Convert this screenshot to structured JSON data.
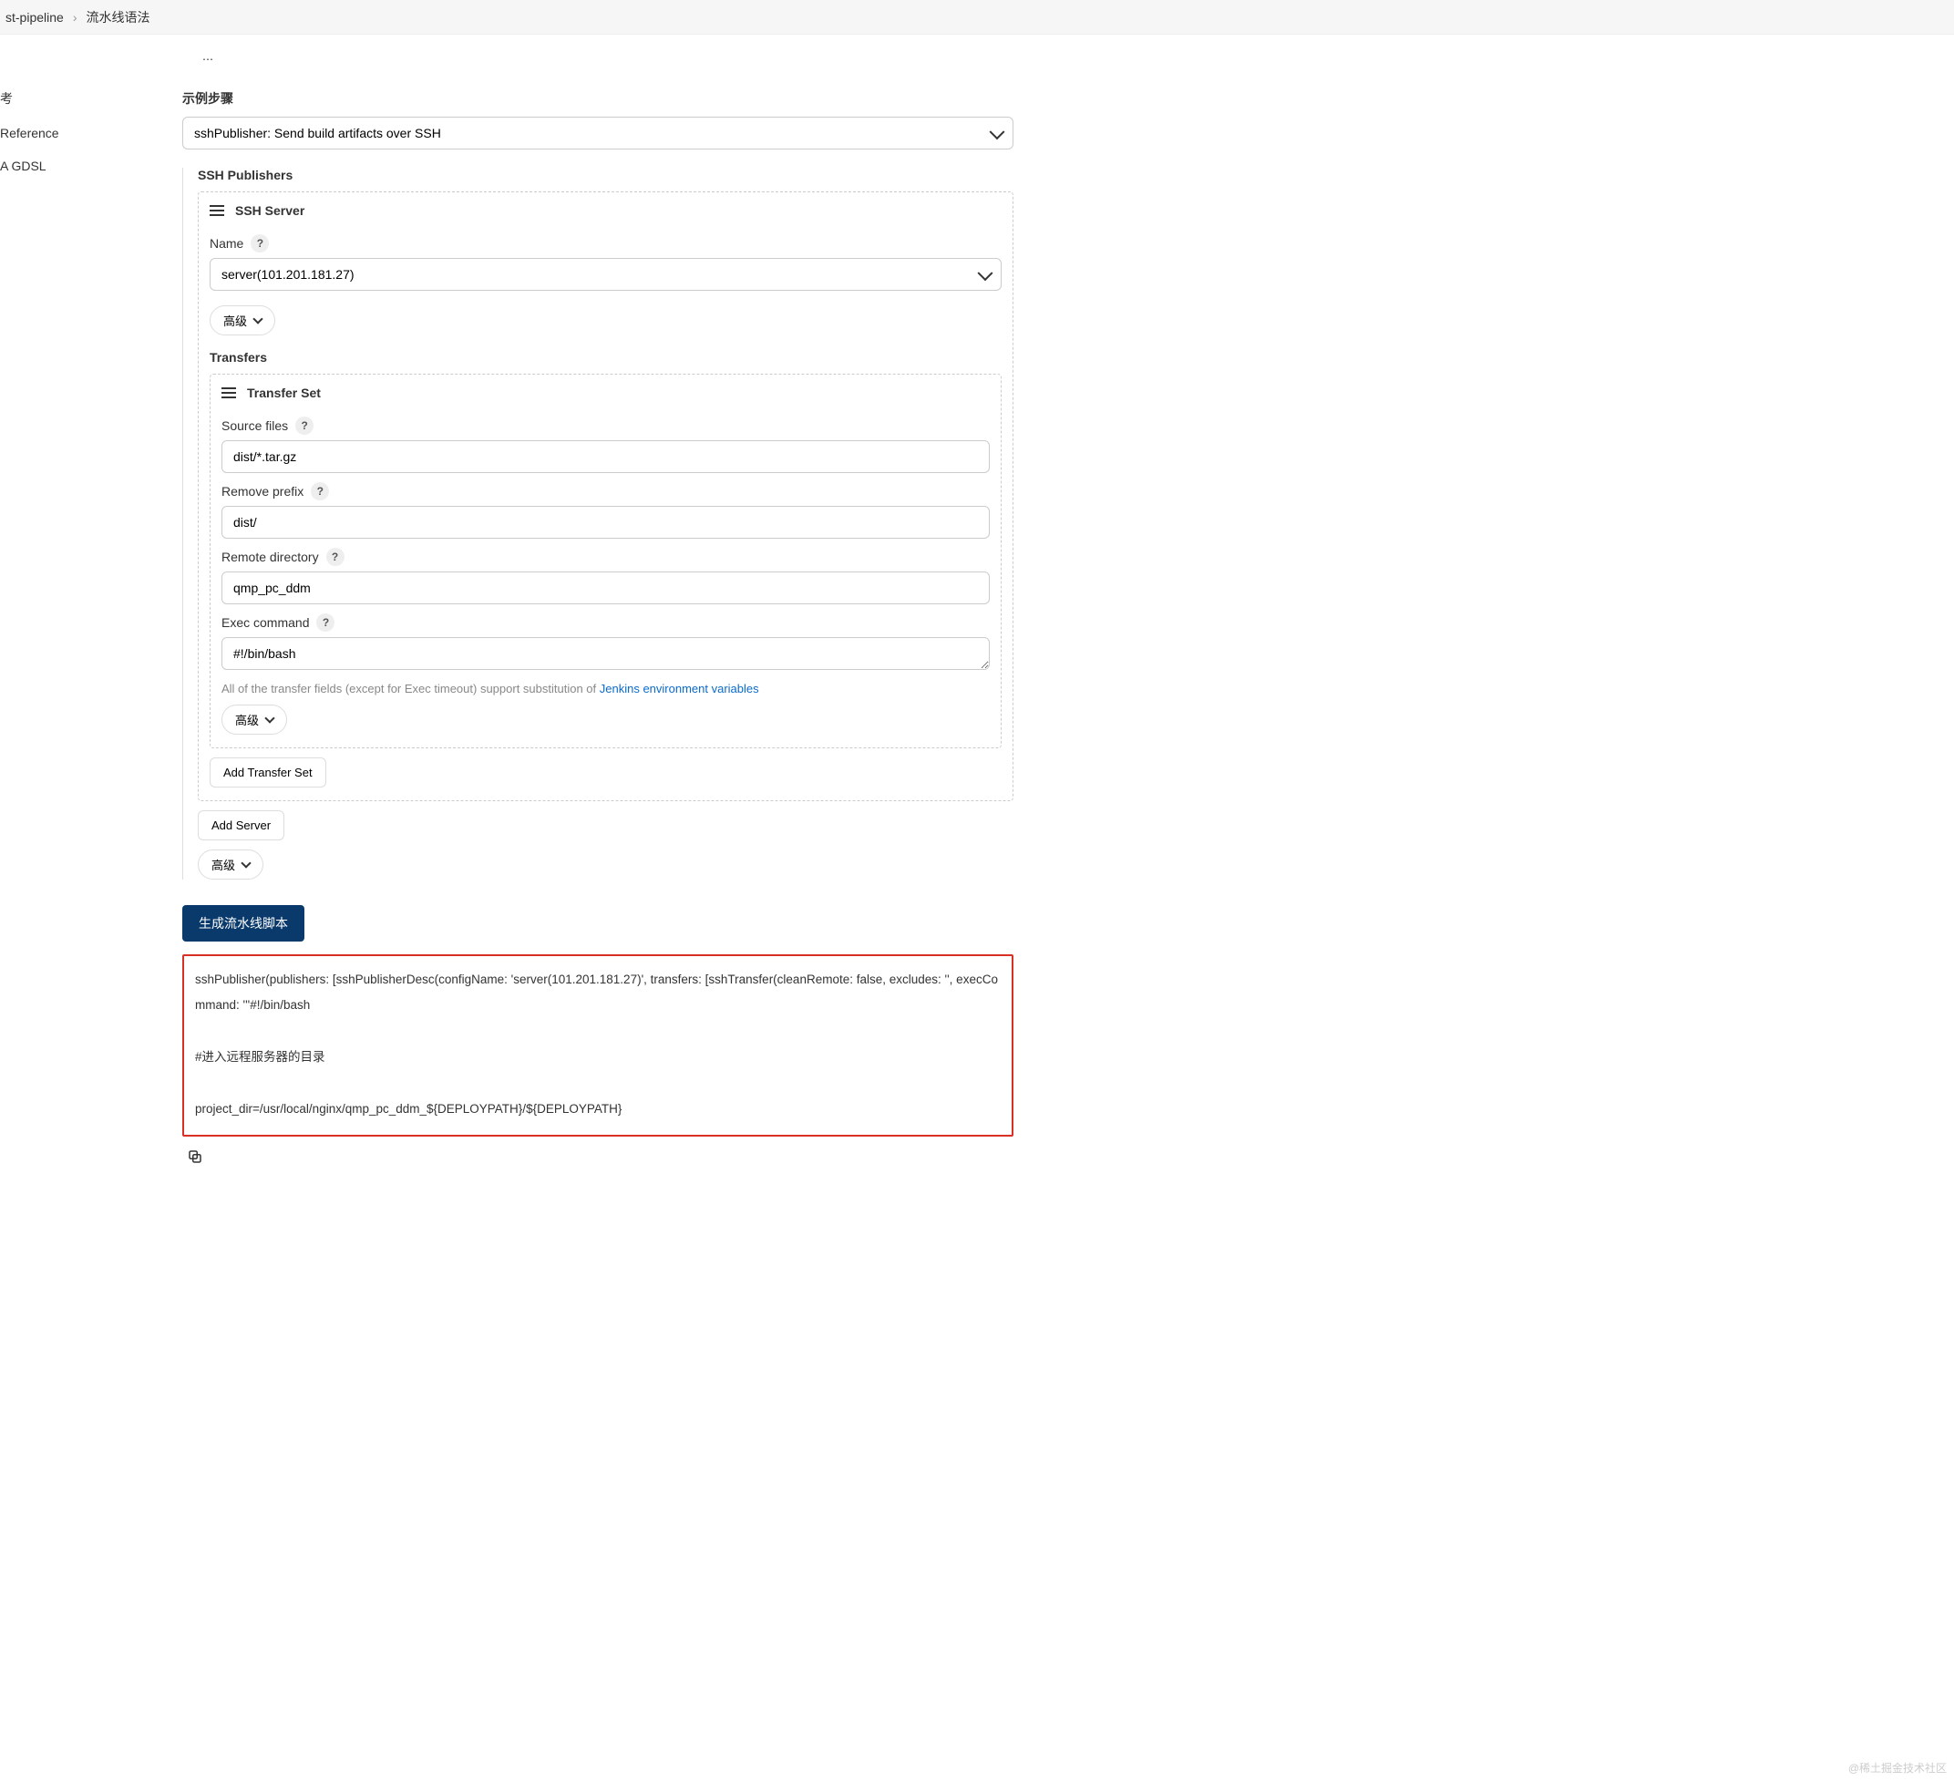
{
  "breadcrumb": {
    "item1": "st-pipeline",
    "item2": "流水线语法"
  },
  "leftNav": {
    "item1": "考",
    "item2": "Reference",
    "item3": "A GDSL"
  },
  "page": {
    "partial": "⋯",
    "stepLabel": "示例步骤",
    "stepSelectValue": "sshPublisher: Send build artifacts over SSH"
  },
  "sshPublishers": {
    "label": "SSH Publishers",
    "server": {
      "title": "SSH Server",
      "nameLabel": "Name",
      "nameValue": "server(101.201.181.27)",
      "advanced": "高级"
    },
    "transfers": {
      "label": "Transfers",
      "setTitle": "Transfer Set",
      "sourceLabel": "Source files",
      "sourceValue": "dist/*.tar.gz",
      "removePrefixLabel": "Remove prefix",
      "removePrefixValue": "dist/",
      "remoteDirLabel": "Remote directory",
      "remoteDirValue": "qmp_pc_ddm",
      "execLabel": "Exec command",
      "execValue": "#!/bin/bash",
      "hintPrefix": "All of the transfer fields (except for Exec timeout) support substitution of ",
      "hintLink": "Jenkins environment variables",
      "advanced": "高级",
      "addTransfer": "Add Transfer Set"
    },
    "addServer": "Add Server",
    "advancedOuter": "高级"
  },
  "actions": {
    "generate": "生成流水线脚本"
  },
  "output": {
    "line1": "sshPublisher(publishers: [sshPublisherDesc(configName: 'server(101.201.181.27)', transfers: [sshTransfer(cleanRemote: false, excludes: '', execCommand: '''#!/bin/bash",
    "line2": "#进入远程服务器的目录",
    "line3": "project_dir=/usr/local/nginx/qmp_pc_ddm_${DEPLOYPATH}/${DEPLOYPATH}"
  },
  "watermark": "@稀土掘金技术社区"
}
